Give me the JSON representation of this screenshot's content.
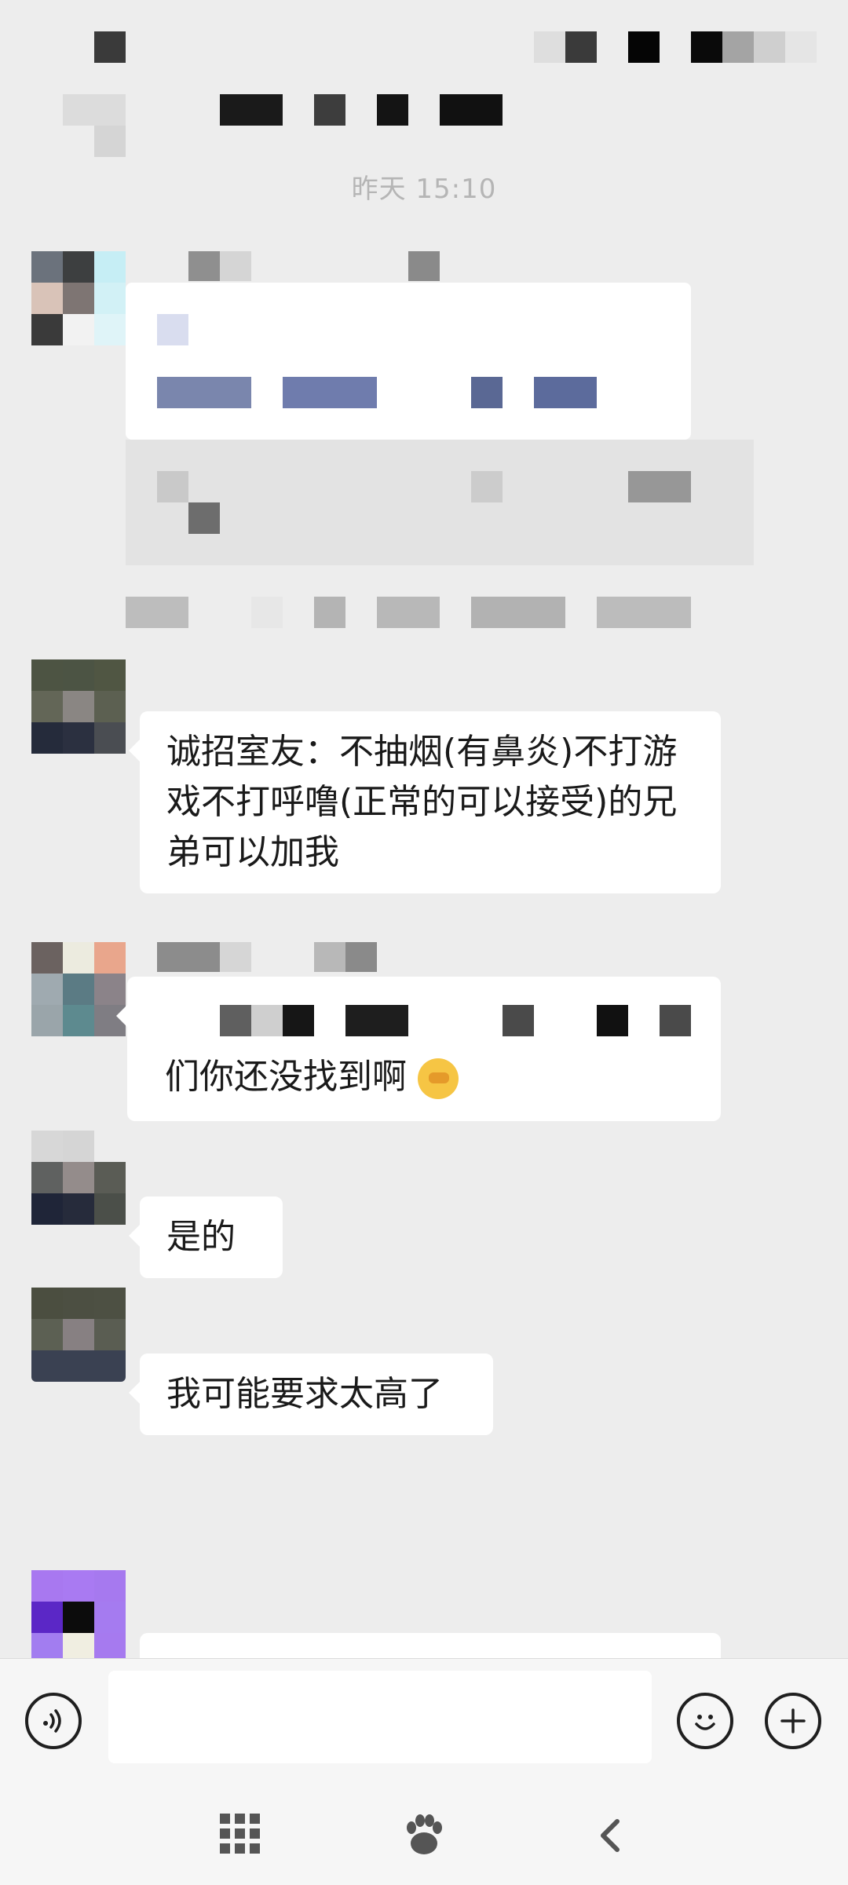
{
  "chat": {
    "timestamp": "昨天 15:10",
    "messages": [
      {
        "sender": "other",
        "text": "诚招室友：不抽烟(有鼻炎)不打游戏不打呼噜(正常的可以接受)的兄弟可以加我"
      },
      {
        "sender": "other",
        "text": "们你还没找到啊"
      },
      {
        "sender": "other",
        "text": "是的"
      },
      {
        "sender": "other",
        "text": "我可能要求太高了"
      }
    ],
    "emoji": "facepalm-emoji"
  },
  "input_bar": {
    "voice_icon": "voice-icon",
    "emoji_icon": "emoji-icon",
    "plus_icon": "plus-icon",
    "placeholder": ""
  },
  "navigation": {
    "icons": [
      "menu-grid-icon",
      "paw-icon",
      "back-icon"
    ]
  },
  "colors": {
    "background": "#ededed",
    "bubble": "#ffffff",
    "text": "#1a1a1a",
    "timestamp": "#b5b5b5"
  }
}
